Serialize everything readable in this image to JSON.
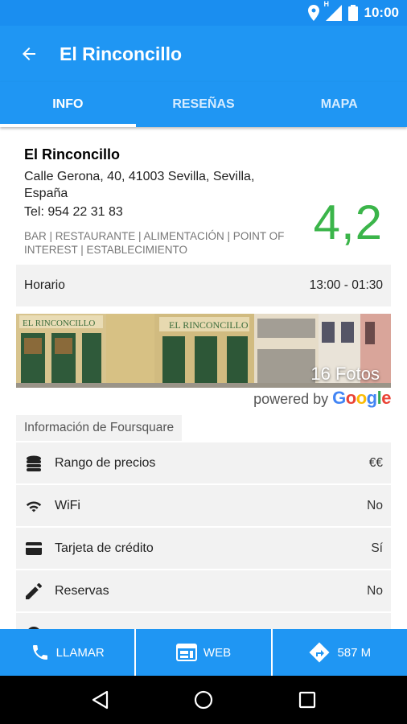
{
  "status_bar": {
    "time": "10:00",
    "network_label": "H"
  },
  "app_bar": {
    "title": "El Rinconcillo"
  },
  "tabs": [
    {
      "label": "INFO",
      "active": true
    },
    {
      "label": "RESEÑAS",
      "active": false
    },
    {
      "label": "MAPA",
      "active": false
    }
  ],
  "place": {
    "name": "El Rinconcillo",
    "address": "Calle Gerona, 40, 41003 Sevilla, Sevilla, España",
    "phone": "Tel: 954 22 31 83",
    "categories": "BAR | RESTAURANTE | ALIMENTACIÓN | POINT OF INTEREST | ESTABLECIMIENTO",
    "rating": "4,2",
    "rating_color": "#3bb54a"
  },
  "hours": {
    "label": "Horario",
    "value": "13:00 - 01:30"
  },
  "photos": {
    "count_label": "16 Fotos",
    "powered_by": "powered by",
    "google": [
      "G",
      "o",
      "o",
      "g",
      "l",
      "e"
    ],
    "google_colors": [
      "#4285f4",
      "#ea4335",
      "#fbbc05",
      "#4285f4",
      "#34a853",
      "#ea4335"
    ]
  },
  "foursquare": {
    "header": "Información de Foursquare",
    "rows": [
      {
        "icon": "coins-icon",
        "label": "Rango de precios",
        "value": "€€"
      },
      {
        "icon": "wifi-icon",
        "label": "WiFi",
        "value": "No"
      },
      {
        "icon": "credit-card-icon",
        "label": "Tarjeta de crédito",
        "value": "Sí"
      },
      {
        "icon": "pencil-icon",
        "label": "Reservas",
        "value": "No"
      }
    ]
  },
  "actions": [
    {
      "icon": "phone-icon",
      "label": "LLAMAR"
    },
    {
      "icon": "web-icon",
      "label": "WEB"
    },
    {
      "icon": "directions-icon",
      "label": "587 M"
    }
  ],
  "colors": {
    "primary": "#1f96f3",
    "status": "#1a8ef0",
    "row_bg": "#f2f2f2"
  }
}
